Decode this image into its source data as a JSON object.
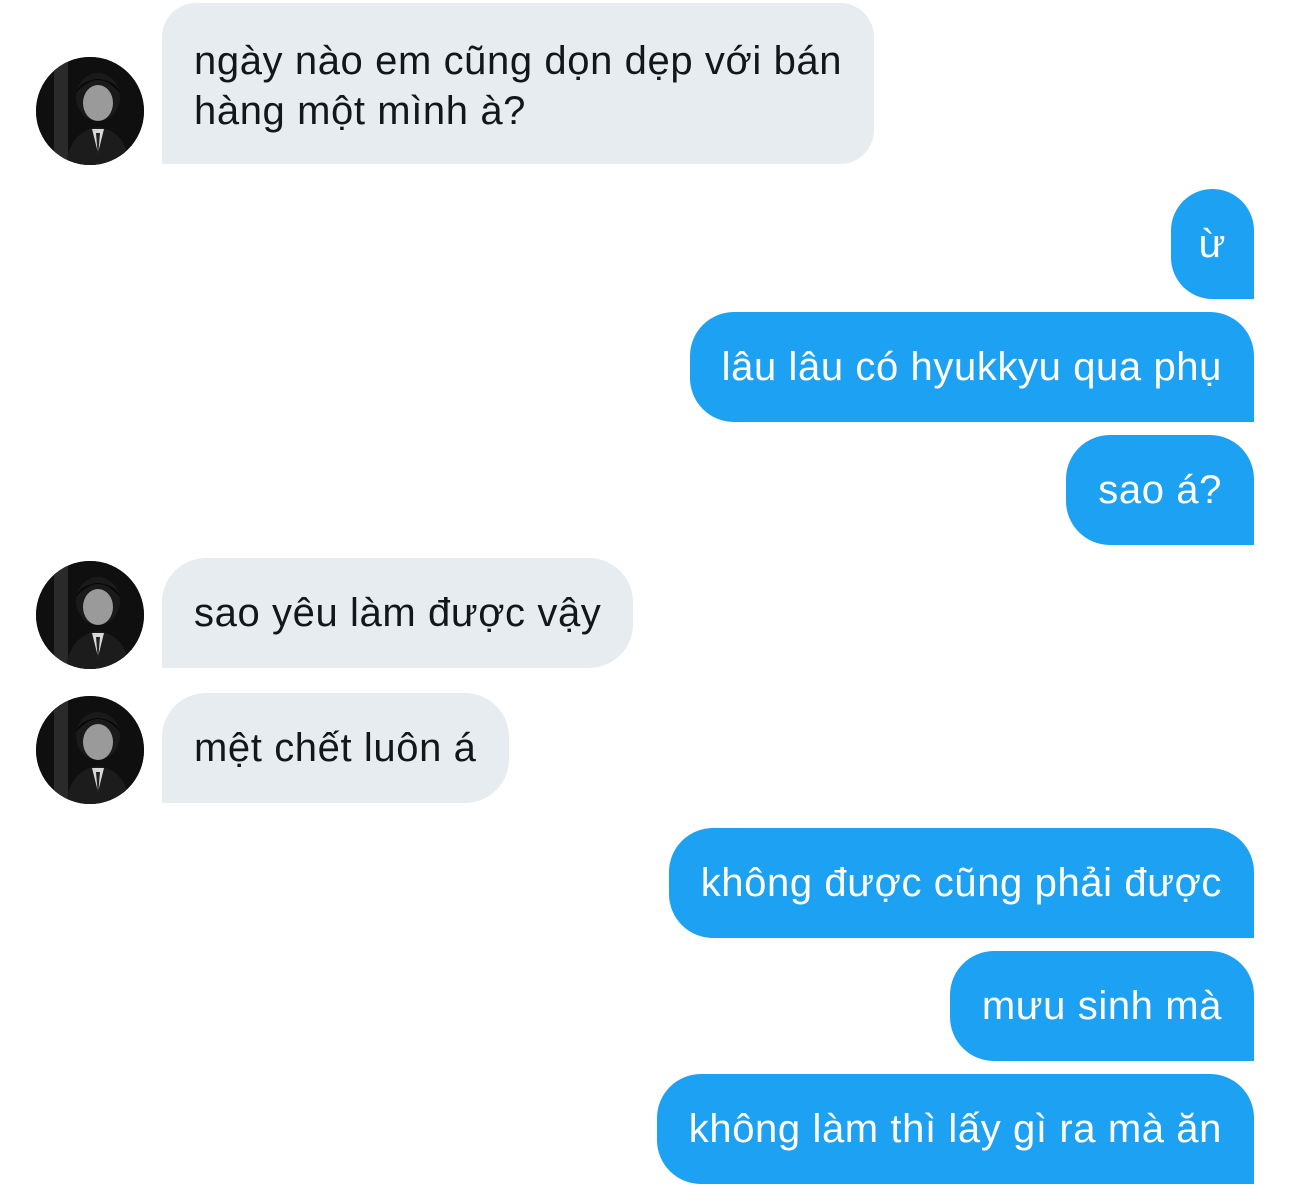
{
  "conversation": {
    "messages": [
      {
        "sender": "other",
        "text": "ngày nào em cũng dọn dẹp với bán hàng một mình à?",
        "lines": [
          "ngày nào em cũng dọn dẹp với bán",
          "hàng một mình à?"
        ]
      },
      {
        "sender": "me",
        "text": "ừ"
      },
      {
        "sender": "me",
        "text": "lâu lâu có hyukkyu qua phụ"
      },
      {
        "sender": "me",
        "text": "sao á?"
      },
      {
        "sender": "other",
        "text": "sao yêu làm được vậy"
      },
      {
        "sender": "other",
        "text": "mệt chết luôn á"
      },
      {
        "sender": "me",
        "text": "không được cũng phải được"
      },
      {
        "sender": "me",
        "text": "mưu sinh mà"
      },
      {
        "sender": "me",
        "text": "không làm thì lấy gì ra mà ăn"
      }
    ]
  },
  "colors": {
    "incoming_bubble": "#e6ecf0",
    "incoming_text": "#14171a",
    "outgoing_bubble": "#1da1f2",
    "outgoing_text": "#ffffff"
  },
  "icons": {
    "avatar": "avatar-photo-icon"
  }
}
